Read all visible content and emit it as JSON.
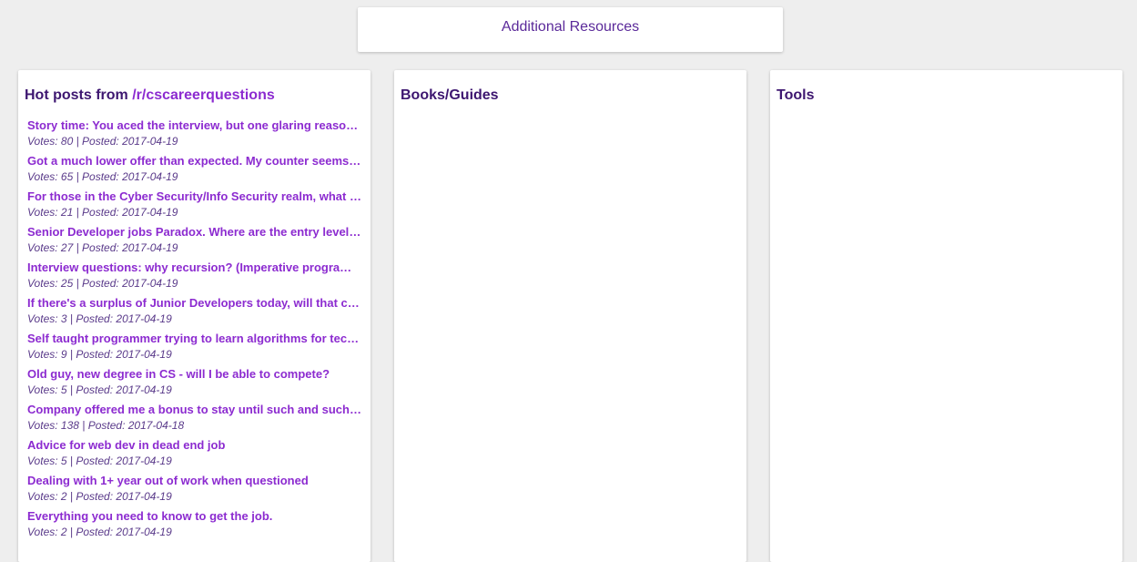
{
  "header": {
    "title": "Additional Resources"
  },
  "reddit": {
    "heading_prefix": "Hot posts from ",
    "subreddit": "/r/cscareerquestions",
    "posts": [
      {
        "title": "Story time: You aced the interview, but one glaring reason kept you from getting the job",
        "meta": "Votes: 80 | Posted: 2017-04-19"
      },
      {
        "title": "Got a much lower offer than expected. My counter seems futile?",
        "meta": "Votes: 65 | Posted: 2017-04-19"
      },
      {
        "title": "For those in the Cyber Security/Info Security realm, what do you do?",
        "meta": "Votes: 21 | Posted: 2017-04-19"
      },
      {
        "title": "Senior Developer jobs Paradox. Where are the entry level jobs?",
        "meta": "Votes: 27 | Posted: 2017-04-19"
      },
      {
        "title": "Interview questions: why recursion? (Imperative programming)",
        "meta": "Votes: 25 | Posted: 2017-04-19"
      },
      {
        "title": "If there's a surplus of Junior Developers today, will that change?",
        "meta": "Votes: 3 | Posted: 2017-04-19"
      },
      {
        "title": "Self taught programmer trying to learn algorithms for technical interviews",
        "meta": "Votes: 9 | Posted: 2017-04-19"
      },
      {
        "title": "Old guy, new degree in CS - will I be able to compete?",
        "meta": "Votes: 5 | Posted: 2017-04-19"
      },
      {
        "title": "Company offered me a bonus to stay until such and such date",
        "meta": "Votes: 138 | Posted: 2017-04-18"
      },
      {
        "title": "Advice for web dev in dead end job",
        "meta": "Votes: 5 | Posted: 2017-04-19"
      },
      {
        "title": "Dealing with 1+ year out of work when questioned",
        "meta": "Votes: 2 | Posted: 2017-04-19"
      },
      {
        "title": "Everything you need to know to get the job.",
        "meta": "Votes: 2 | Posted: 2017-04-19"
      }
    ]
  },
  "books": {
    "heading": "Books/Guides"
  },
  "tools": {
    "heading": "Tools"
  },
  "colors": {
    "background": "#eeeeee",
    "heading": "#3d1670",
    "link": "#8c2bd0",
    "meta": "#5a3a8a"
  }
}
